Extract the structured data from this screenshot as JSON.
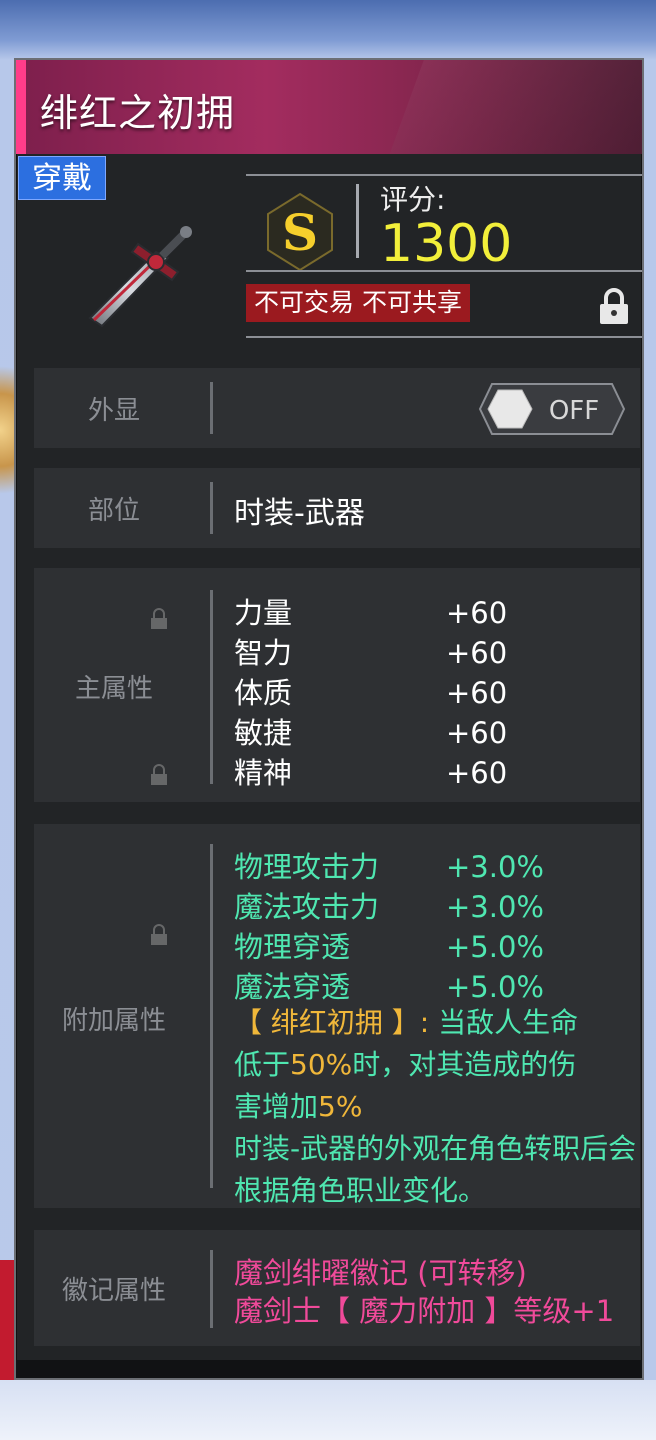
{
  "item": {
    "name": "绯红之初拥",
    "equipped_badge": "穿戴",
    "grade": "S",
    "score_label": "评分:",
    "score_value": "1300",
    "tags": "不可交易 不可共享"
  },
  "rows": {
    "appearance": {
      "label": "外显",
      "toggle_state": "OFF"
    },
    "slot": {
      "label": "部位",
      "value": "时装-武器"
    },
    "main_attr": {
      "label": "主属性",
      "stats": [
        {
          "name": "力量",
          "value": "+60"
        },
        {
          "name": "智力",
          "value": "+60"
        },
        {
          "name": "体质",
          "value": "+60"
        },
        {
          "name": "敏捷",
          "value": "+60"
        },
        {
          "name": "精神",
          "value": "+60"
        }
      ]
    },
    "extra_attr": {
      "label": "附加属性",
      "stats": [
        {
          "name": "物理攻击力",
          "value": "+3.0%"
        },
        {
          "name": "魔法攻击力",
          "value": "+3.0%"
        },
        {
          "name": "物理穿透",
          "value": "+5.0%"
        },
        {
          "name": "魔法穿透",
          "value": "+5.0%"
        }
      ],
      "effect_line1_a": "【 绯红初拥 】:",
      "effect_line1_b": " 当敌人生命",
      "effect_line2_a": "低于",
      "effect_line2_b": "50%",
      "effect_line2_c": "时，对其造成的伤",
      "effect_line3_a": "害增加",
      "effect_line3_b": "5%",
      "note": "时装-武器的外观在角色转职后会根据角色职业变化。"
    },
    "emblem_attr": {
      "label": "徽记属性",
      "line1": "魔剑绯曜徽记 (可转移)",
      "line2": "魔剑士【 魔力附加 】等级+1"
    }
  },
  "colors": {
    "score": "#f2ef3a",
    "green_text": "#4fe7b1",
    "orange_text": "#f0b73a",
    "pink_text": "#f04a9a",
    "title_bar": "#a32c5f",
    "badge": "#2c6fe0",
    "tag_bg": "#9b1a1f"
  }
}
